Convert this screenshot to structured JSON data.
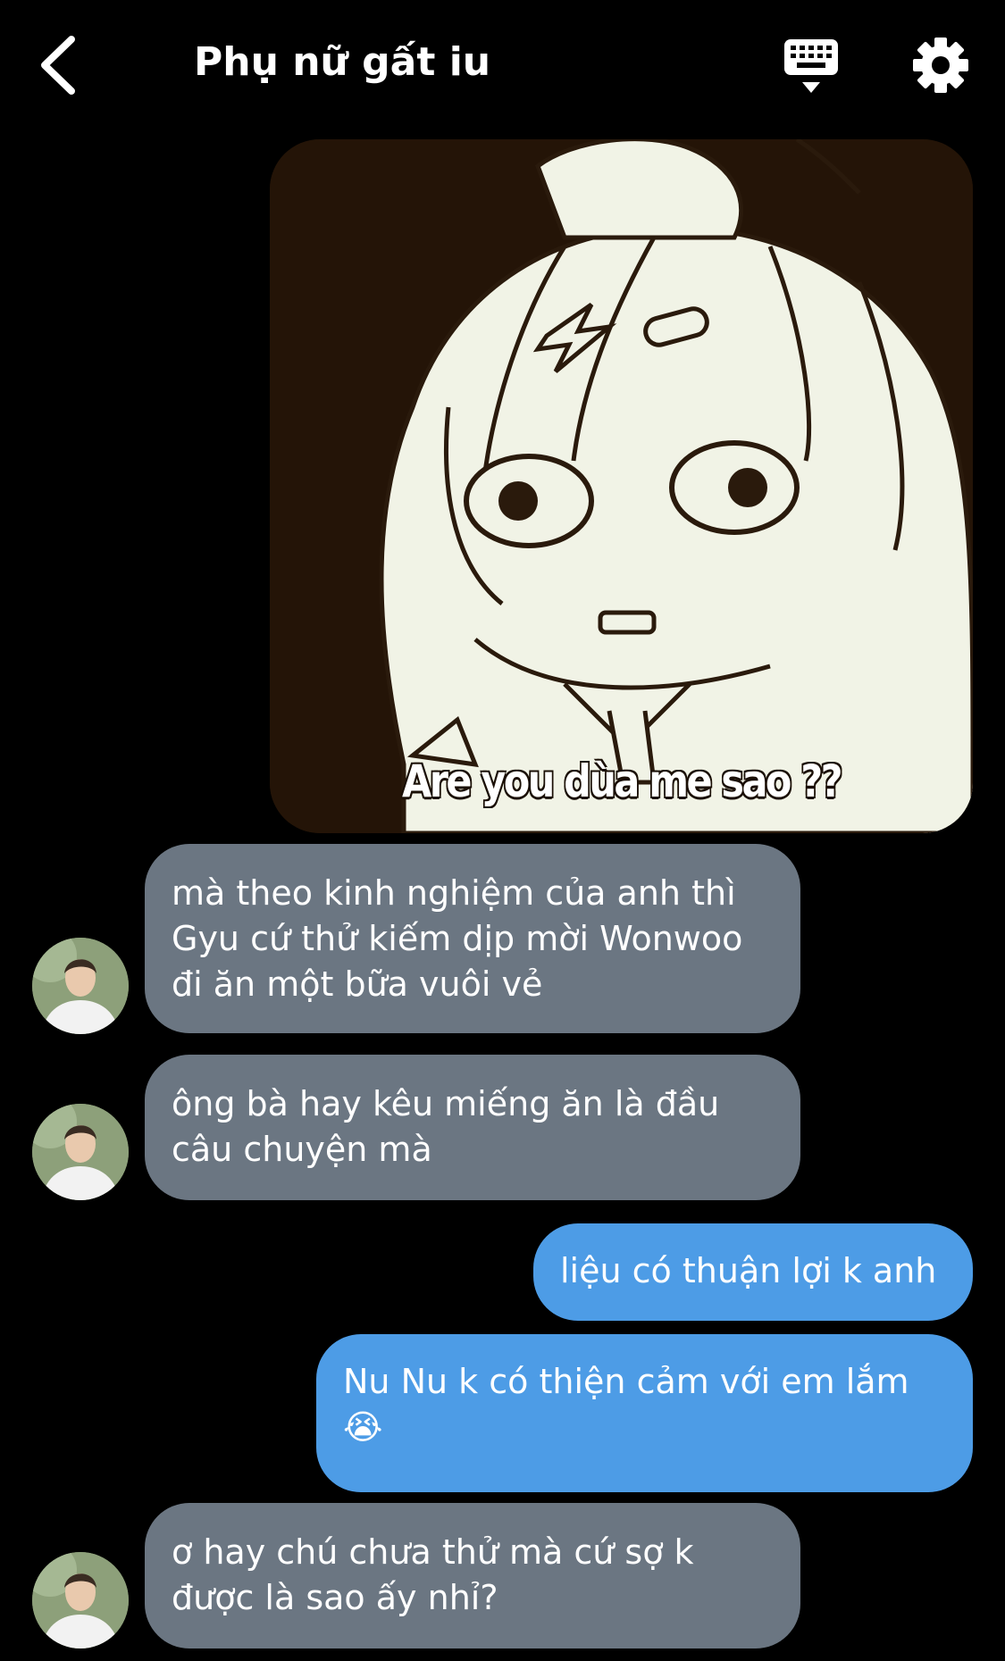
{
  "header": {
    "title": "Phụ nữ gất iu",
    "icons": {
      "back": "chevron-left-icon",
      "keyboard": "keyboard-icon",
      "settings": "gear-icon"
    }
  },
  "image_message": {
    "caption": "Are you dùa me sao ??"
  },
  "messages": [
    {
      "side": "incoming",
      "lines": [
        "mà theo kinh nghiệm của anh thì",
        "Gyu cứ thử kiếm dịp mời Wonwoo",
        "đi ăn một bữa vuôi vẻ"
      ]
    },
    {
      "side": "incoming",
      "lines": [
        "ông bà hay kêu miếng ăn là đầu",
        "câu chuyện mà"
      ]
    },
    {
      "side": "outgoing",
      "lines": [
        "liệu có thuận lợi k anh"
      ]
    },
    {
      "side": "outgoing",
      "lines": [
        "Nu Nu k có thiện cảm với em lắm"
      ],
      "emoji": "😭"
    },
    {
      "side": "incoming",
      "lines": [
        "ơ hay chú chưa thử mà cứ sợ k",
        "được là sao ấy nhỉ?"
      ]
    }
  ],
  "colors": {
    "incoming_bubble": "#6b7682",
    "outgoing_bubble": "#4d9ce6",
    "background": "#000000"
  }
}
